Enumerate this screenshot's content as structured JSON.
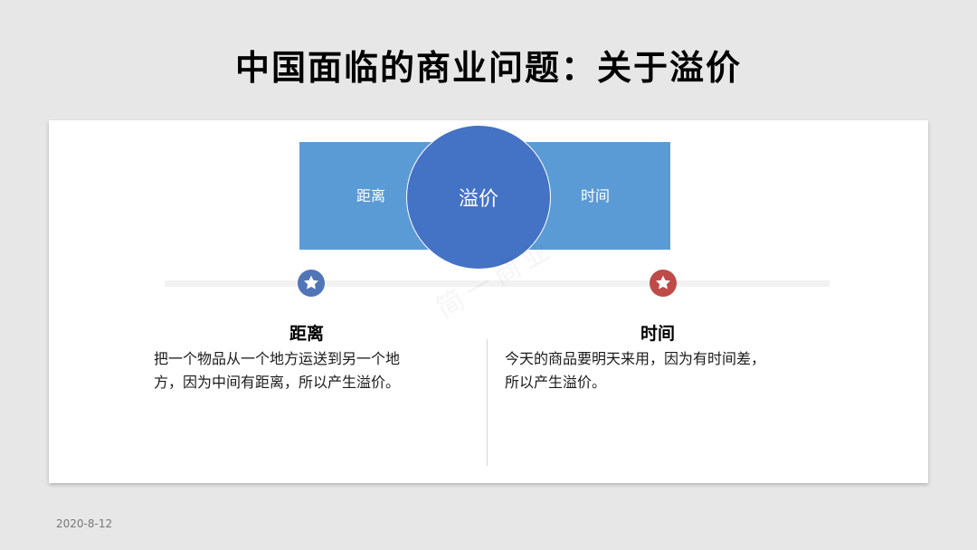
{
  "slide": {
    "title": "中国面临的商业问题：关于溢价",
    "date": "2020-8-12"
  },
  "diagram": {
    "left_label": "距离",
    "center_label": "溢价",
    "right_label": "时间",
    "colors": {
      "bar": "#5b9bd5",
      "circle": "#4472c4",
      "left_marker": "#5076b8",
      "right_marker": "#be4b48"
    }
  },
  "columns": [
    {
      "title": "距离",
      "lines": [
        "把一个物品从一个地方运送到另一个地",
        "方，因为中间有距离，所以产生溢价。"
      ]
    },
    {
      "title": "时间",
      "lines": [
        "今天的商品要明天来用，因为有时间差，",
        "所以产生溢价。"
      ]
    }
  ],
  "watermark": "简一商业"
}
